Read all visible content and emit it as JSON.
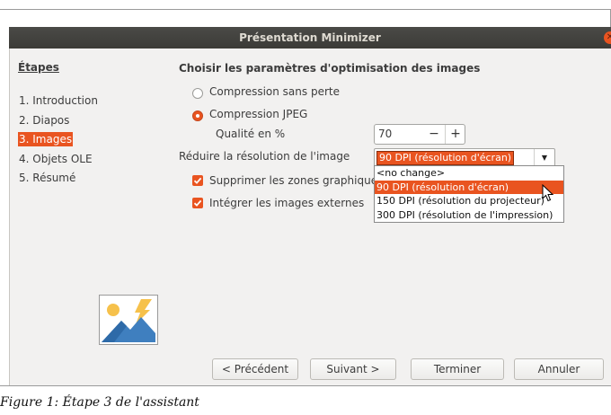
{
  "window": {
    "title": "Présentation Minimizer",
    "close_icon": "close-icon"
  },
  "sidebar": {
    "heading": "Étapes",
    "steps": [
      {
        "label": "1. Introduction",
        "active": false
      },
      {
        "label": "2. Diapos",
        "active": false
      },
      {
        "label": "3. Images",
        "active": true
      },
      {
        "label": "4. Objets OLE",
        "active": false
      },
      {
        "label": "5. Résumé",
        "active": false
      }
    ],
    "image_icon": "landscape-image-icon"
  },
  "content": {
    "title": "Choisir les paramètres d'optimisation des images",
    "lossless_label": "Compression sans perte",
    "jpeg_label": "Compression JPEG",
    "selected_compression": "Compression JPEG",
    "quality_label": "Qualité en %",
    "quality_value": "70",
    "minus_label": "−",
    "plus_label": "+",
    "resolution_label": "Réduire la résolution de l'image",
    "resolution_value": "90 DPI (résolution d'écran)",
    "resolution_options": [
      "<no change>",
      "90 DPI (résolution d'écran)",
      "150 DPI (résolution du projecteur)",
      "300 DPI (résolution de l'impression)"
    ],
    "crop_label": "Supprimer les zones graphiques",
    "crop_checked": true,
    "embed_label": "Intégrer les images externes",
    "embed_checked": true
  },
  "buttons": {
    "previous": "< Précédent",
    "next": "Suivant >",
    "finish": "Terminer",
    "cancel": "Annuler"
  },
  "caption": "Figure 1: Étape 3 de l'assistant",
  "colors": {
    "accent": "#e95420",
    "titlebar": "#3c3b37",
    "window_bg": "#f2f1f0"
  }
}
